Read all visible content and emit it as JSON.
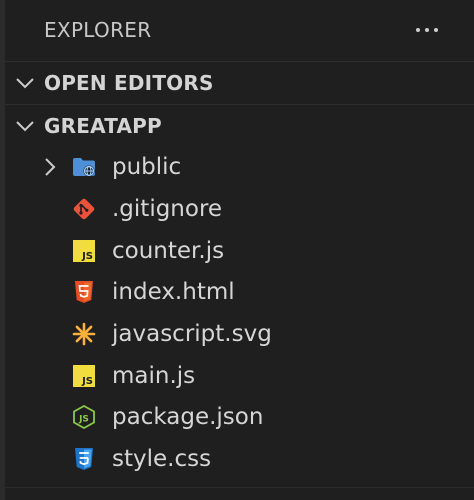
{
  "explorer": {
    "title": "EXPLORER",
    "more_actions_icon": "ellipsis-icon"
  },
  "sections": {
    "open_editors": {
      "label": "OPEN EDITORS",
      "expanded": false
    },
    "project": {
      "label": "GREATAPP",
      "expanded": true
    }
  },
  "files": [
    {
      "name": "public",
      "type": "folder",
      "icon": "folder-public-icon",
      "icon_color": "#4e8fd6"
    },
    {
      "name": ".gitignore",
      "type": "file",
      "icon": "git-icon",
      "icon_color": "#e8533a"
    },
    {
      "name": "counter.js",
      "type": "file",
      "icon": "javascript-icon",
      "icon_color": "#f1dd3f"
    },
    {
      "name": "index.html",
      "type": "file",
      "icon": "html5-icon",
      "icon_color": "#e44d26"
    },
    {
      "name": "javascript.svg",
      "type": "file",
      "icon": "svg-icon",
      "icon_color": "#ffb13b"
    },
    {
      "name": "main.js",
      "type": "file",
      "icon": "javascript-icon",
      "icon_color": "#f1dd3f"
    },
    {
      "name": "package.json",
      "type": "file",
      "icon": "nodejs-icon",
      "icon_color": "#8cc84b"
    },
    {
      "name": "style.css",
      "type": "file",
      "icon": "css3-icon",
      "icon_color": "#42a5f5"
    }
  ]
}
